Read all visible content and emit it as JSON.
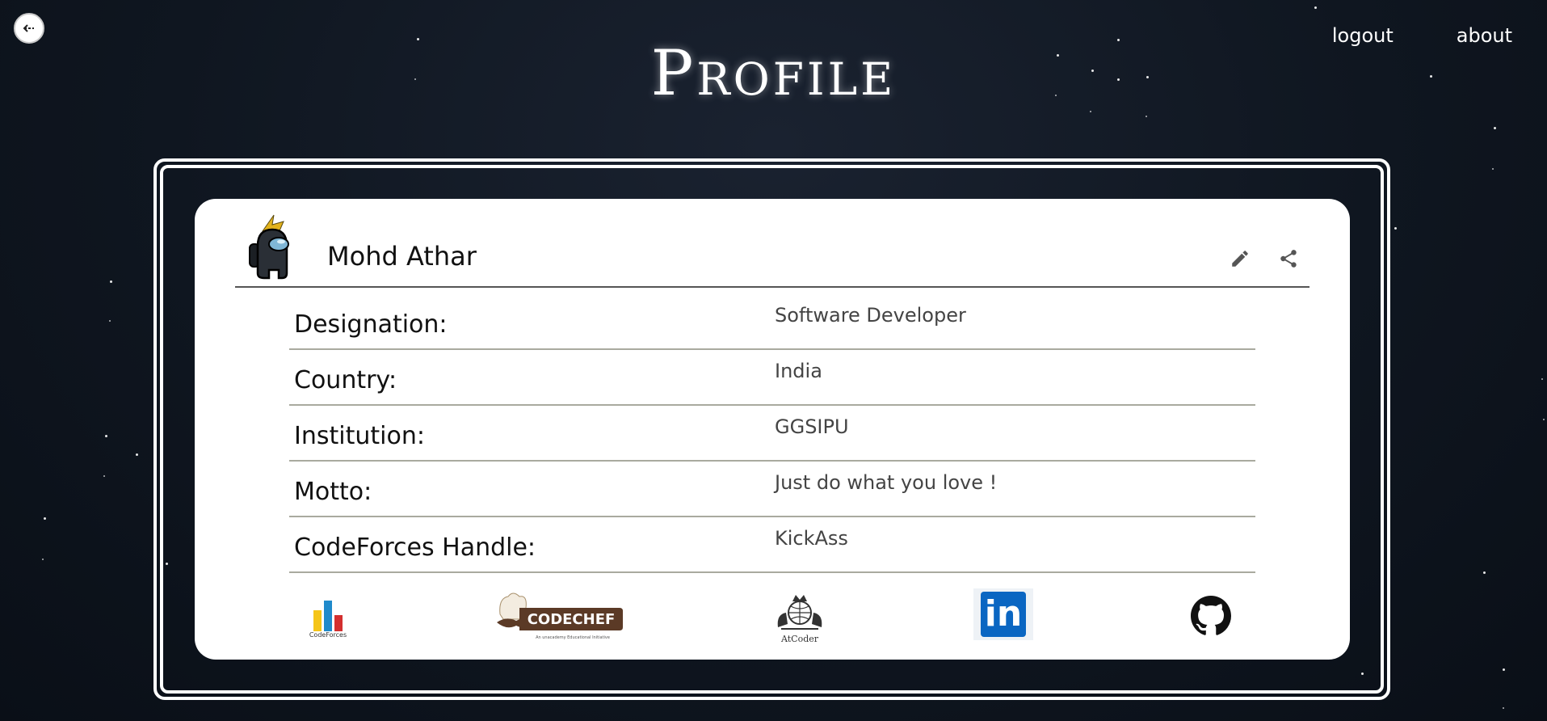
{
  "nav": {
    "back_icon": "arrow-left-icon",
    "logout": "logout",
    "about": "about"
  },
  "page": {
    "title": "Profile"
  },
  "profile": {
    "name": "Mohd Athar",
    "avatar": "among-us-crewmate-avatar",
    "actions": {
      "edit_icon": "pencil-icon",
      "share_icon": "share-icon"
    },
    "fields": [
      {
        "label": "Designation:",
        "value": "Software Developer"
      },
      {
        "label": "Country:",
        "value": "India"
      },
      {
        "label": "Institution:",
        "value": "GGSIPU"
      },
      {
        "label": "Motto:",
        "value": "Just do what you love !"
      },
      {
        "label": "CodeForces Handle:",
        "value": "KickAss"
      }
    ]
  },
  "links": {
    "codeforces": {
      "label": "CodeForces"
    },
    "codechef": {
      "label": "CODECHEF",
      "tagline": "An unacademy Educational Initiative"
    },
    "atcoder": {
      "label": "AtCoder"
    },
    "linkedin": {
      "label": "in"
    },
    "github": {
      "icon": "github-icon"
    }
  },
  "colors": {
    "background": "#0f1620",
    "card": "#ffffff",
    "codechef_brown": "#5b3a26",
    "linkedin_blue": "#0a66c2"
  }
}
